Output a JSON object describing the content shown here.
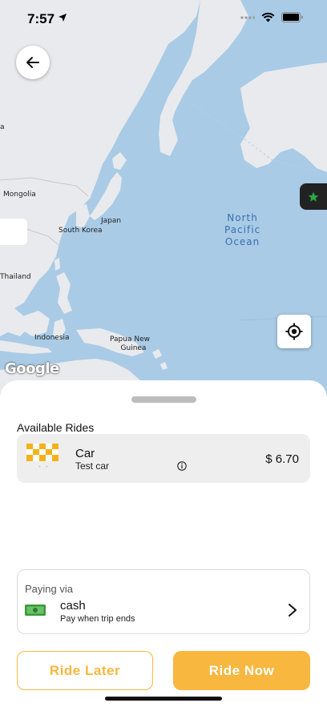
{
  "status_bar": {
    "time": "7:57"
  },
  "map": {
    "labels": {
      "mongolia": "Mongolia",
      "japan": "Japan",
      "south_korea": "South Korea",
      "thailand": "Thailand",
      "indonesia": "Indonesia",
      "papua_line1": "Papua New",
      "papua_line2": "Guinea",
      "ocean_line1": "North",
      "ocean_line2": "Pacific",
      "ocean_line3": "Ocean",
      "edge_label": "a"
    },
    "attribution": "Google"
  },
  "sheet": {
    "title": "Available Rides",
    "rides": [
      {
        "name": "Car",
        "description": "Test car",
        "price": "$ 6.70",
        "dash": "- -"
      }
    ],
    "payment": {
      "title": "Paying via",
      "method": "cash",
      "subtitle": "Pay when trip ends"
    },
    "buttons": {
      "ride_later": "Ride Later",
      "ride_now": "Ride Now"
    }
  },
  "colors": {
    "accent": "#f8b73e",
    "map_water": "#a9cbe6",
    "map_land": "#e8eaed",
    "fav_star": "#2aa844"
  }
}
